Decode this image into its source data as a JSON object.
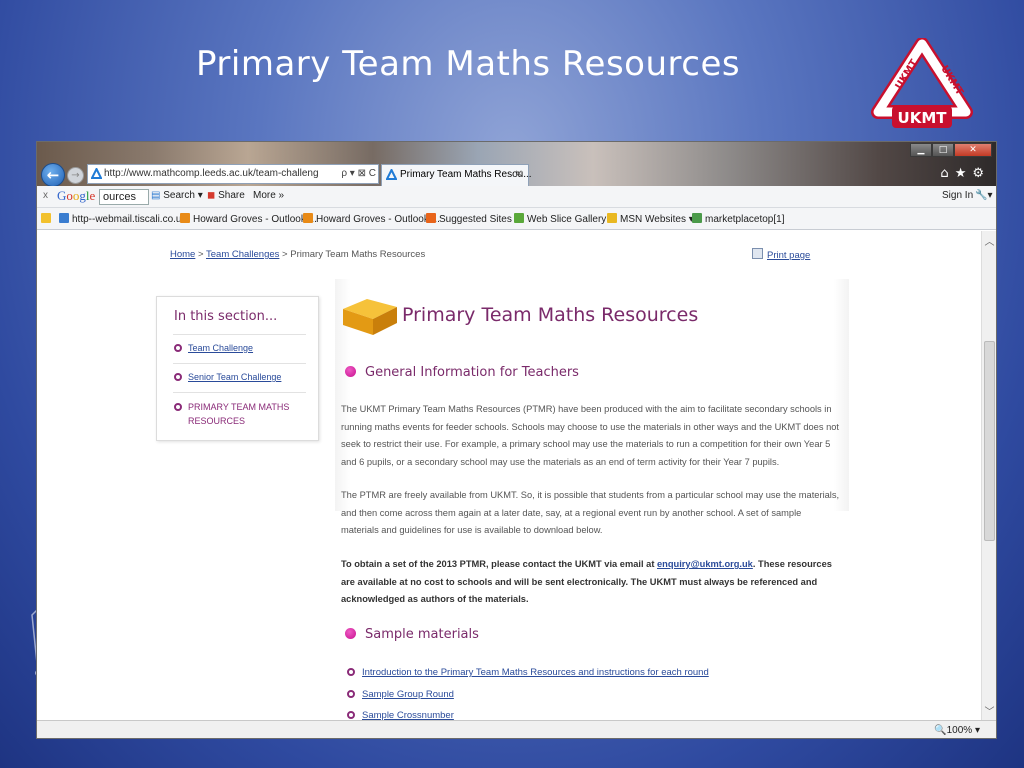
{
  "slide": {
    "title": "Primary Team Maths Resources",
    "logo_text": "UKMT",
    "logo_side_left": "UKMT",
    "logo_side_right": "UKMT"
  },
  "browser": {
    "url": "http://www.mathcomp.leeds.ac.uk/team-challeng",
    "address_tools": "ρ ▾ ⊠ C",
    "tab_title": "Primary Team Maths Resou...",
    "toolbar": {
      "close": "x",
      "google_query": "ources",
      "search_label": "Search ▾",
      "share_label": "Share",
      "more_label": "More »",
      "sign_in": "Sign In"
    },
    "favorites": [
      "http--webmail.tiscali.co.u...",
      "Howard Groves - Outlook ...",
      "Howard Groves - Outlook ...",
      "Suggested Sites ▾",
      "Web Slice Gallery ▾",
      "MSN Websites ▾",
      "marketplacetop[1]"
    ],
    "zoom": "100%"
  },
  "page": {
    "breadcrumb": {
      "home": "Home",
      "sep1": " > ",
      "team": "Team Challenges",
      "sep2": " > ",
      "current": "Primary Team Maths Resources"
    },
    "print": "Print page",
    "section": {
      "title": "In this section...",
      "items": [
        "Team Challenge",
        "Senior Team Challenge"
      ],
      "current_line1": "PRIMARY TEAM MATHS",
      "current_line2": "RESOURCES"
    },
    "heading": "Primary Team Maths Resources",
    "general_heading": "General Information for Teachers",
    "para1": "The UKMT Primary Team Maths Resources (PTMR) have been produced with the aim to facilitate secondary schools in running maths events for feeder schools. Schools may choose to use the materials in other ways and the UKMT does not seek to restrict their use. For example, a primary school may use the materials to run a competition for their own Year 5 and 6 pupils, or a secondary school may use the materials as an end of term activity for their Year 7 pupils.",
    "para2": "The PTMR are freely available from UKMT. So, it is possible that students from a particular school may use the materials, and then come across them again at a later date, say, at a regional event run by another school. A set of sample materials and guidelines for use is available to download below.",
    "para3_before": "To obtain a set of the 2013 PTMR, please contact the UKMT via email at ",
    "para3_email": "enquiry@ukmt.org.uk",
    "para3_after": ". These resources are available at no cost to schools and will be sent electronically. The UKMT must always be referenced and acknowledged as authors of the materials.",
    "sample_heading": "Sample materials",
    "samples": [
      "Introduction to the Primary Team Maths Resources and instructions for each round",
      "Sample Group Round",
      "Sample Crossnumber"
    ]
  }
}
